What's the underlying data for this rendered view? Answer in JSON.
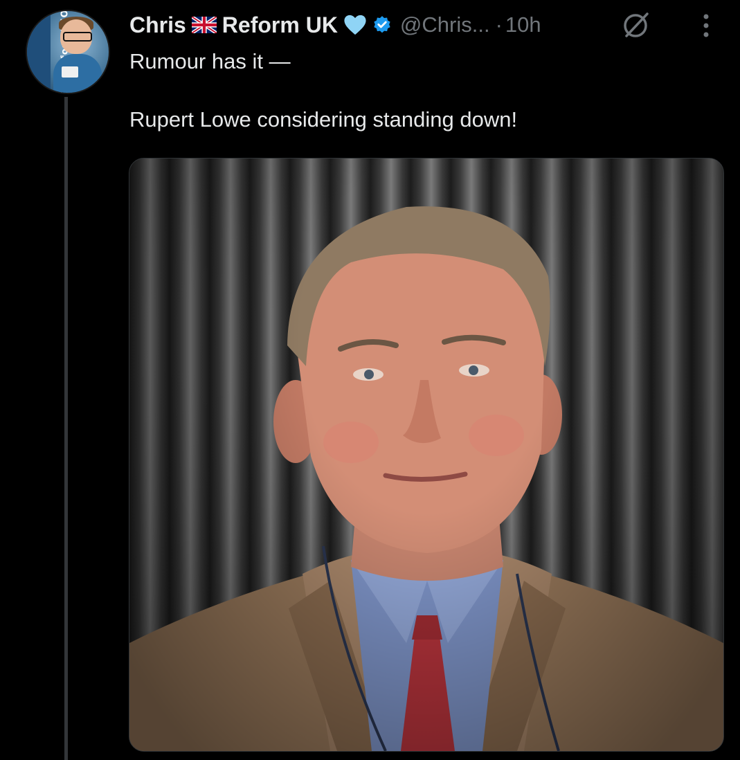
{
  "author": {
    "name": "Chris",
    "name_suffix": "Reform UK",
    "handle": "@Chris...",
    "time": "10h",
    "avatar_badge_text": "WOMEN for REFORM"
  },
  "icons": {
    "flag": "uk-flag-icon",
    "heart": "light-blue-heart-icon",
    "verified": "verified-badge-icon",
    "grok": "grok-icon",
    "more": "more-options-icon"
  },
  "colors": {
    "background": "#000000",
    "text_primary": "#e7e9ea",
    "text_secondary": "#71767b",
    "verified_blue": "#1d9bf0",
    "heart_blue": "#8fd4f5"
  },
  "tweet": {
    "lines": [
      "Rumour has it —",
      "Rupert Lowe considering standing down!"
    ]
  },
  "media": {
    "type": "photo",
    "subject": "man in tan suit with blue shirt and red tie"
  }
}
